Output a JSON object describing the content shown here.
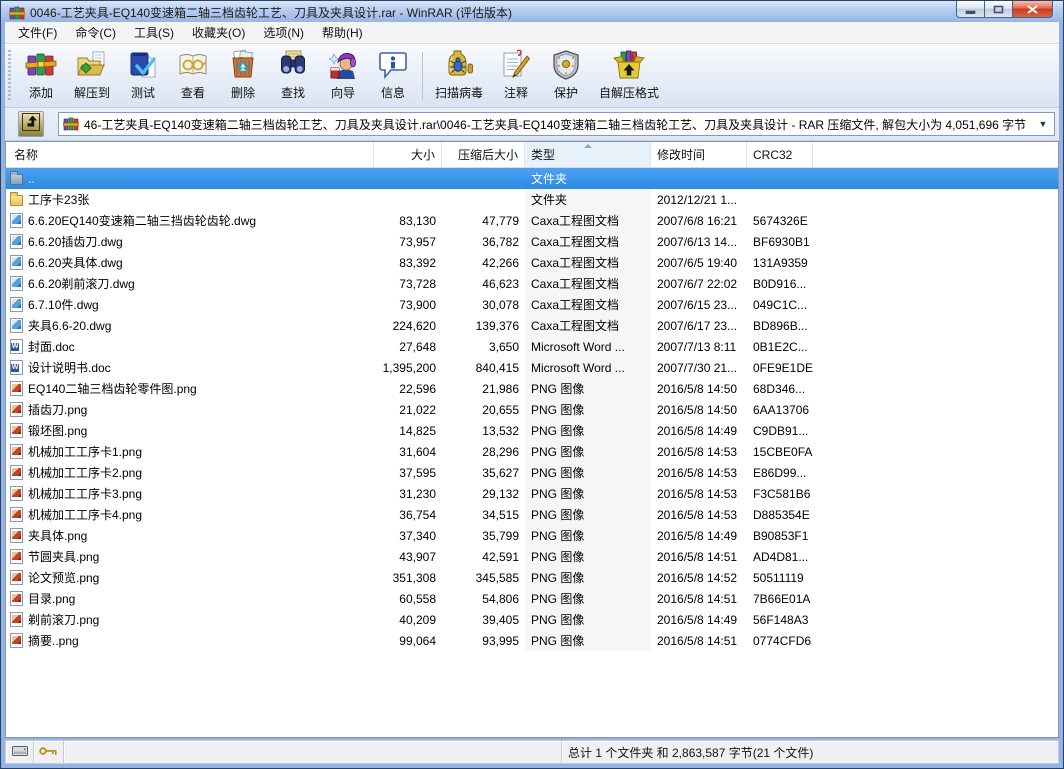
{
  "window": {
    "title": "0046-工艺夹具-EQ140变速箱二轴三档齿轮工艺、刀具及夹具设计.rar - WinRAR (评估版本)",
    "app_icon": "winrar-books-icon",
    "colors": {
      "selection": "#2e8ae0",
      "frame_blue": "#93b3e2",
      "close_button_red": "#d1492c",
      "sorted_header_bg": "#e7f2fb"
    }
  },
  "menu": {
    "items": [
      {
        "label": "文件(F)"
      },
      {
        "label": "命令(C)"
      },
      {
        "label": "工具(S)"
      },
      {
        "label": "收藏夹(O)"
      },
      {
        "label": "选项(N)"
      },
      {
        "label": "帮助(H)"
      }
    ]
  },
  "toolbar": {
    "items": [
      {
        "icon": "add-icon",
        "label": "添加"
      },
      {
        "icon": "extract-to-icon",
        "label": "解压到"
      },
      {
        "icon": "test-icon",
        "label": "测试"
      },
      {
        "icon": "view-icon",
        "label": "查看"
      },
      {
        "icon": "delete-icon",
        "label": "删除"
      },
      {
        "icon": "find-icon",
        "label": "查找"
      },
      {
        "icon": "wizard-icon",
        "label": "向导"
      },
      {
        "icon": "info-icon",
        "label": "信息"
      },
      {
        "icon": "virus-scan-icon",
        "label": "扫描病毒"
      },
      {
        "icon": "comment-icon",
        "label": "注释"
      },
      {
        "icon": "protect-icon",
        "label": "保护"
      },
      {
        "icon": "sfx-icon",
        "label": "自解压格式"
      }
    ]
  },
  "address_bar": {
    "up_button_icon": "up-level-icon",
    "archive_icon": "winrar-books-icon",
    "path": "46-工艺夹具-EQ140变速箱二轴三档齿轮工艺、刀具及夹具设计.rar\\0046-工艺夹具-EQ140变速箱二轴三档齿轮工艺、刀具及夹具设计 - RAR 压缩文件, 解包大小为 4,051,696 字节",
    "dropdown_icon": "chevron-down-icon",
    "dropdown_glyph": "▼"
  },
  "file_list": {
    "columns": [
      {
        "key": "name",
        "label": "名称"
      },
      {
        "key": "size",
        "label": "大小",
        "align": "right"
      },
      {
        "key": "packed",
        "label": "压缩后大小",
        "align": "right"
      },
      {
        "key": "type",
        "label": "类型",
        "sorted": "asc"
      },
      {
        "key": "modified",
        "label": "修改时间"
      },
      {
        "key": "crc",
        "label": "CRC32"
      }
    ],
    "rows": [
      {
        "icon": "up",
        "name": "..",
        "size": "",
        "packed": "",
        "type": "文件夹",
        "modified": "",
        "crc": "",
        "selected": true
      },
      {
        "icon": "folder",
        "name": "工序卡23张",
        "size": "",
        "packed": "",
        "type": "文件夹",
        "modified": "2012/12/21 1...",
        "crc": ""
      },
      {
        "icon": "dwg",
        "name": "6.6.20EQ140变速箱二轴三挡齿轮齿轮.dwg",
        "size": "83,130",
        "packed": "47,779",
        "type": "Caxa工程图文档",
        "modified": "2007/6/8 16:21",
        "crc": "5674326E"
      },
      {
        "icon": "dwg",
        "name": "6.6.20插齿刀.dwg",
        "size": "73,957",
        "packed": "36,782",
        "type": "Caxa工程图文档",
        "modified": "2007/6/13 14...",
        "crc": "BF6930B1"
      },
      {
        "icon": "dwg",
        "name": "6.6.20夹具体.dwg",
        "size": "83,392",
        "packed": "42,266",
        "type": "Caxa工程图文档",
        "modified": "2007/6/5 19:40",
        "crc": "131A9359"
      },
      {
        "icon": "dwg",
        "name": "6.6.20剃前滚刀.dwg",
        "size": "73,728",
        "packed": "46,623",
        "type": "Caxa工程图文档",
        "modified": "2007/6/7 22:02",
        "crc": "B0D916..."
      },
      {
        "icon": "dwg",
        "name": "6.7.10件.dwg",
        "size": "73,900",
        "packed": "30,078",
        "type": "Caxa工程图文档",
        "modified": "2007/6/15 23...",
        "crc": "049C1C..."
      },
      {
        "icon": "dwg",
        "name": "夹具6.6-20.dwg",
        "size": "224,620",
        "packed": "139,376",
        "type": "Caxa工程图文档",
        "modified": "2007/6/17 23...",
        "crc": "BD896B..."
      },
      {
        "icon": "doc",
        "name": "封面.doc",
        "size": "27,648",
        "packed": "3,650",
        "type": "Microsoft Word ...",
        "modified": "2007/7/13 8:11",
        "crc": "0B1E2C..."
      },
      {
        "icon": "doc",
        "name": "设计说明书.doc",
        "size": "1,395,200",
        "packed": "840,415",
        "type": "Microsoft Word ...",
        "modified": "2007/7/30 21...",
        "crc": "0FE9E1DE"
      },
      {
        "icon": "png",
        "name": "EQ140二轴三档齿轮零件图.png",
        "size": "22,596",
        "packed": "21,986",
        "type": "PNG 图像",
        "modified": "2016/5/8 14:50",
        "crc": "68D346..."
      },
      {
        "icon": "png",
        "name": "插齿刀.png",
        "size": "21,022",
        "packed": "20,655",
        "type": "PNG 图像",
        "modified": "2016/5/8 14:50",
        "crc": "6AA13706"
      },
      {
        "icon": "png",
        "name": "锻坯图.png",
        "size": "14,825",
        "packed": "13,532",
        "type": "PNG 图像",
        "modified": "2016/5/8 14:49",
        "crc": "C9DB91..."
      },
      {
        "icon": "png",
        "name": "机械加工工序卡1.png",
        "size": "31,604",
        "packed": "28,296",
        "type": "PNG 图像",
        "modified": "2016/5/8 14:53",
        "crc": "15CBE0FA"
      },
      {
        "icon": "png",
        "name": "机械加工工序卡2.png",
        "size": "37,595",
        "packed": "35,627",
        "type": "PNG 图像",
        "modified": "2016/5/8 14:53",
        "crc": "E86D99..."
      },
      {
        "icon": "png",
        "name": "机械加工工序卡3.png",
        "size": "31,230",
        "packed": "29,132",
        "type": "PNG 图像",
        "modified": "2016/5/8 14:53",
        "crc": "F3C581B6"
      },
      {
        "icon": "png",
        "name": "机械加工工序卡4.png",
        "size": "36,754",
        "packed": "34,515",
        "type": "PNG 图像",
        "modified": "2016/5/8 14:53",
        "crc": "D885354E"
      },
      {
        "icon": "png",
        "name": "夹具体.png",
        "size": "37,340",
        "packed": "35,799",
        "type": "PNG 图像",
        "modified": "2016/5/8 14:49",
        "crc": "B90853F1"
      },
      {
        "icon": "png",
        "name": "节圆夹具.png",
        "size": "43,907",
        "packed": "42,591",
        "type": "PNG 图像",
        "modified": "2016/5/8 14:51",
        "crc": "AD4D81..."
      },
      {
        "icon": "png",
        "name": "论文预览.png",
        "size": "351,308",
        "packed": "345,585",
        "type": "PNG 图像",
        "modified": "2016/5/8 14:52",
        "crc": "50511119"
      },
      {
        "icon": "png",
        "name": "目录.png",
        "size": "60,558",
        "packed": "54,806",
        "type": "PNG 图像",
        "modified": "2016/5/8 14:51",
        "crc": "7B66E01A"
      },
      {
        "icon": "png",
        "name": "剃前滚刀.png",
        "size": "40,209",
        "packed": "39,405",
        "type": "PNG 图像",
        "modified": "2016/5/8 14:49",
        "crc": "56F148A3"
      },
      {
        "icon": "png",
        "name": "摘要..png",
        "size": "99,064",
        "packed": "93,995",
        "type": "PNG 图像",
        "modified": "2016/5/8 14:51",
        "crc": "0774CFD6"
      }
    ]
  },
  "status_bar": {
    "icons": [
      "drive-icon",
      "key-icon"
    ],
    "totals": "总计 1 个文件夹 和 2,863,587 字节(21 个文件)"
  }
}
